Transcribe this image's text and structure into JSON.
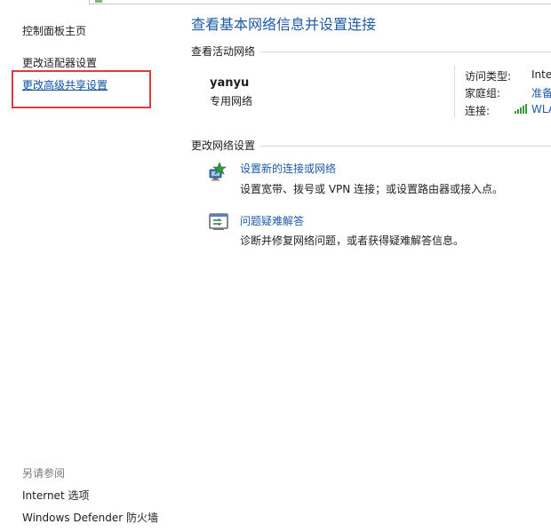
{
  "sidebar": {
    "home_label": "控制面板主页",
    "adapter_label": "更改适配器设置",
    "advanced_sharing_label": "更改高级共享设置",
    "see_also_title": "另请参阅",
    "see_also_items": [
      "Internet 选项",
      "Windows Defender 防火墙"
    ]
  },
  "main": {
    "title": "查看基本网络信息并设置连接",
    "active_networks_header": "查看活动网络",
    "network": {
      "name": "yanyu",
      "type": "专用网络",
      "access_type_label": "访问类型:",
      "access_type_value": "Inte",
      "homegroup_label": "家庭组:",
      "homegroup_value": "准备",
      "connection_label": "连接:",
      "connection_value": "WLA"
    },
    "change_settings_header": "更改网络设置",
    "tasks": [
      {
        "link": "设置新的连接或网络",
        "desc": "设置宽带、拨号或 VPN 连接；或设置路由器或接入点。",
        "icon": "network-setup-icon"
      },
      {
        "link": "问题疑难解答",
        "desc": "诊断并修复网络问题，或者获得疑难解答信息。",
        "icon": "troubleshoot-icon"
      }
    ]
  },
  "colors": {
    "link_blue": "#1d5aa5",
    "highlight_red": "#e0393e",
    "wifi_green": "#3a9b35"
  }
}
